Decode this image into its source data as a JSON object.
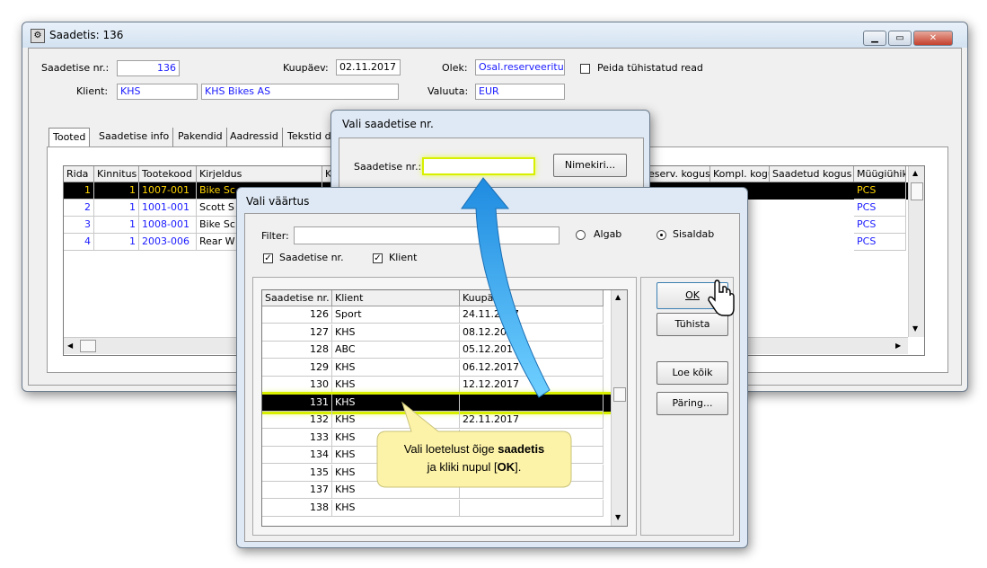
{
  "main_window": {
    "title": "Saadetis: 136",
    "saadetise_nr_label": "Saadetise nr.:",
    "saadetise_nr_value": "136",
    "kuupaev_label": "Kuupäev:",
    "kuupaev_value": "02.11.2017",
    "olek_label": "Olek:",
    "olek_value": "Osal.reserveeritud",
    "peida_label": "Peida tühistatud read",
    "klient_label": "Klient:",
    "klient_code": "KHS",
    "klient_name": "KHS Bikes AS",
    "valuuta_label": "Valuuta:",
    "valuuta_value": "EUR",
    "tabs": [
      "Tooted",
      "Saadetise info",
      "Pakendid",
      "Aadressid",
      "Tekstid d"
    ],
    "table_headers": [
      "Rida",
      "Kinnitus",
      "Tootekood",
      "Kirjeldus",
      "K"
    ],
    "table_headers_right": [
      "eserv. kogus",
      "Kompl. kogu",
      "Saadetud kogus",
      "Müügiühik"
    ],
    "rows": [
      {
        "rida": "1",
        "kinnitus": "1",
        "kood": "1007-001",
        "kirjeldus": "Bike Sc",
        "uhik": "PCS"
      },
      {
        "rida": "2",
        "kinnitus": "1",
        "kood": "1001-001",
        "kirjeldus": "Scott S",
        "uhik": "PCS"
      },
      {
        "rida": "3",
        "kinnitus": "1",
        "kood": "1008-001",
        "kirjeldus": "Bike Sc",
        "uhik": "PCS"
      },
      {
        "rida": "4",
        "kinnitus": "1",
        "kood": "2003-006",
        "kirjeldus": "Rear W",
        "uhik": "PCS"
      }
    ]
  },
  "saadetis_dialog": {
    "title": "Vali saadetise nr.",
    "label": "Saadetise nr.:",
    "nimekiri_label": "Nimekiri..."
  },
  "vaartus_dialog": {
    "title": "Vali väärtus",
    "filter_label": "Filter:",
    "algab_label": "Algab",
    "sisaldab_label": "Sisaldab",
    "chk_saadetise_label": "Saadetise nr.",
    "chk_klient_label": "Klient",
    "headers": [
      "Saadetise nr.",
      "Klient",
      "Kuupäev"
    ],
    "rows": [
      {
        "nr": "126",
        "klient": "Sport",
        "kuupaev": "24.11.2017"
      },
      {
        "nr": "127",
        "klient": "KHS",
        "kuupaev": "08.12.2017"
      },
      {
        "nr": "128",
        "klient": "ABC",
        "kuupaev": "05.12.2017"
      },
      {
        "nr": "129",
        "klient": "KHS",
        "kuupaev": "06.12.2017"
      },
      {
        "nr": "130",
        "klient": "KHS",
        "kuupaev": "12.12.2017"
      },
      {
        "nr": "131",
        "klient": "KHS",
        "kuupaev": ""
      },
      {
        "nr": "132",
        "klient": "KHS",
        "kuupaev": "22.11.2017"
      },
      {
        "nr": "133",
        "klient": "KHS",
        "kuupaev": ""
      },
      {
        "nr": "134",
        "klient": "KHS",
        "kuupaev": ""
      },
      {
        "nr": "135",
        "klient": "KHS",
        "kuupaev": ""
      },
      {
        "nr": "137",
        "klient": "KHS",
        "kuupaev": ""
      },
      {
        "nr": "138",
        "klient": "KHS",
        "kuupaev": ""
      }
    ],
    "ok_label": "OK",
    "tuhista_label": "Tühista",
    "loe_koik_label": "Loe kõik",
    "paring_label": "Päring..."
  },
  "callout": {
    "line1_prefix": "Vali loetelust õige ",
    "line1_bold": "saadetis",
    "line2_prefix": "ja kliki nupul [",
    "line2_bold": "OK",
    "line2_suffix": "]."
  },
  "colors": {
    "highlight": "#d8f000",
    "selected_row": "#000000",
    "callout_bg": "#fdf3a8",
    "arrow": "#2a9be8"
  }
}
